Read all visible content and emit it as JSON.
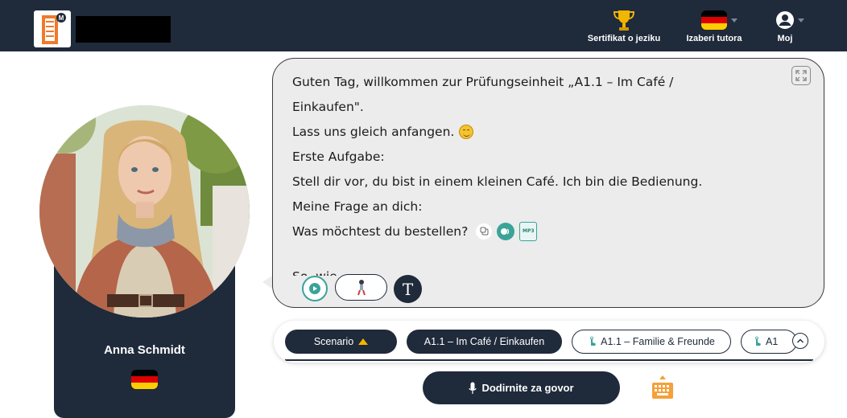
{
  "header": {
    "logo_icon": "ladder-logo-icon",
    "nav": [
      {
        "label": "Sertifikat o jeziku",
        "icon": "trophy-icon"
      },
      {
        "label": "Izaberi tutora",
        "icon": "german-flag-icon"
      },
      {
        "label": "Moj",
        "icon": "user-icon"
      }
    ]
  },
  "tutor": {
    "name": "Anna Schmidt",
    "flag_icon": "german-flag-icon"
  },
  "chat": {
    "lines": [
      "Guten Tag, willkommen zur Prüfungseinheit „A1.1 – Im Café /",
      "Einkaufen\".",
      "Lass uns gleich anfangen.",
      "Erste Aufgabe:",
      "Stell dir vor, du bist in einem kleinen Café. Ich bin die Bedienung.",
      "Meine Frage an dich:",
      "Was möchtest du bestellen?"
    ],
    "cut_text": "So, wie",
    "mp3_label": "MP3",
    "text_button_label": "T"
  },
  "scenarios": {
    "toggle_label": "Scenario",
    "items": [
      {
        "label": "A1.1 – Im Café / Einkaufen",
        "active": true
      },
      {
        "label": "A1.1 – Familie & Freunde",
        "active": false
      },
      {
        "label": "A1",
        "active": false
      }
    ]
  },
  "speak": {
    "label": "Dodirnite za govor",
    "icon": "microphone-icon"
  },
  "colors": {
    "navy": "#1f2a3b",
    "teal": "#3aa39a",
    "bubble": "#ececec",
    "gold": "#f2b600",
    "orange": "#f5a03a"
  }
}
